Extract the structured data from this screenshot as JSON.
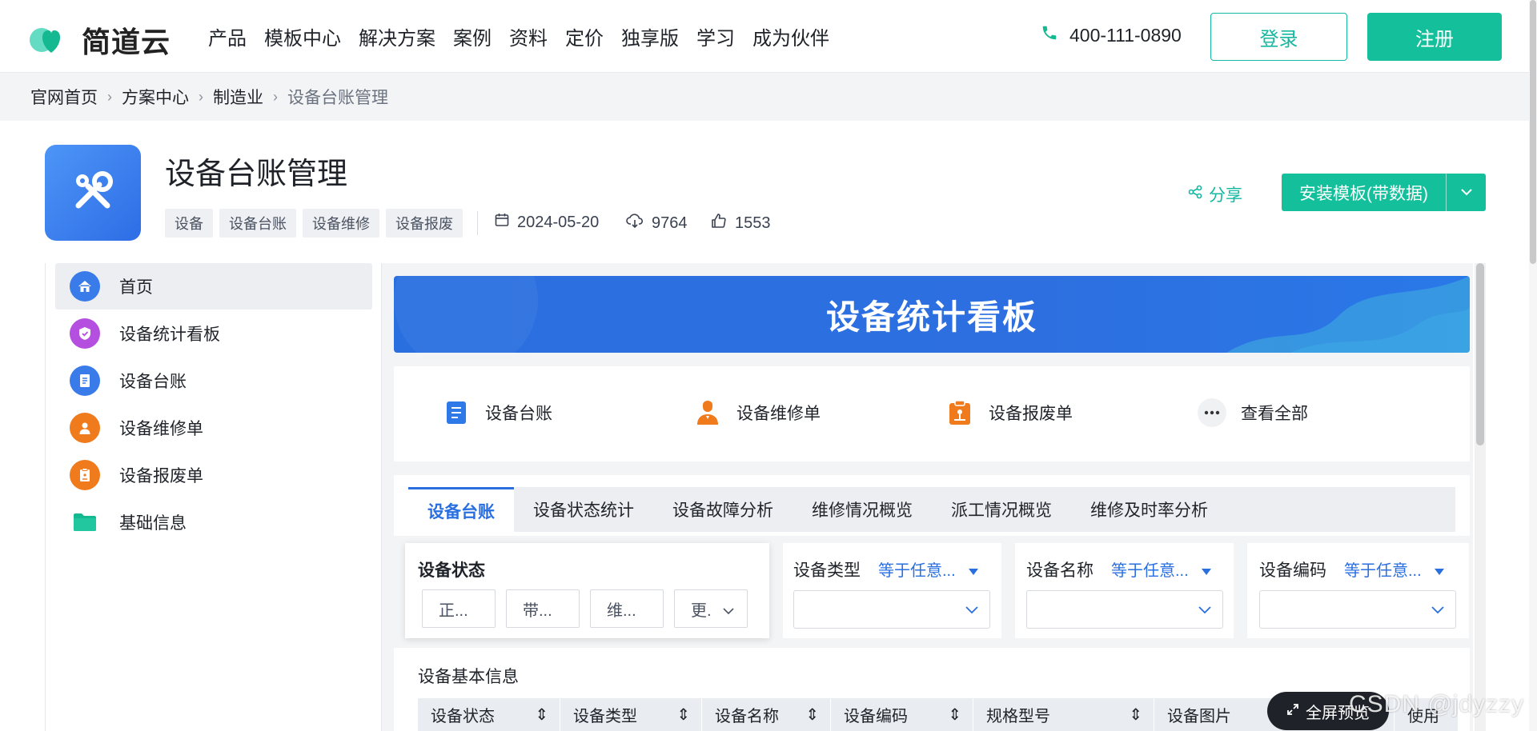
{
  "brand": {
    "name": "简道云"
  },
  "nav": {
    "items": [
      "产品",
      "模板中心",
      "解决方案",
      "案例",
      "资料",
      "定价",
      "独享版",
      "学习",
      "成为伙伴"
    ]
  },
  "header": {
    "phone": "400-111-0890",
    "login": "登录",
    "register": "注册"
  },
  "breadcrumb": [
    "官网首页",
    "方案中心",
    "制造业",
    "设备台账管理"
  ],
  "template": {
    "title": "设备台账管理",
    "tags": [
      "设备",
      "设备台账",
      "设备维修",
      "设备报废"
    ],
    "date": "2024-05-20",
    "downloads": "9764",
    "likes": "1553",
    "share": "分享",
    "install": "安装模板(带数据)"
  },
  "sidebar": {
    "items": [
      {
        "label": "首页",
        "icon": "home-icon",
        "color": "#3a7bea"
      },
      {
        "label": "设备统计看板",
        "icon": "shield-icon",
        "color": "#b44fe0"
      },
      {
        "label": "设备台账",
        "icon": "document-icon",
        "color": "#3a7bea"
      },
      {
        "label": "设备维修单",
        "icon": "worker-icon",
        "color": "#f07b1c"
      },
      {
        "label": "设备报废单",
        "icon": "clipboard-icon",
        "color": "#f07b1c"
      },
      {
        "label": "基础信息",
        "icon": "folder-icon",
        "color": "#14b891"
      }
    ]
  },
  "banner": {
    "title": "设备统计看板"
  },
  "quick_links": [
    "设备台账",
    "设备维修单",
    "设备报废单",
    "查看全部"
  ],
  "tabs": [
    "设备台账",
    "设备状态统计",
    "设备故障分析",
    "维修情况概览",
    "派工情况概览",
    "维修及时率分析"
  ],
  "filters": {
    "status_label": "设备状态",
    "status_chips": [
      "正...",
      "带...",
      "维...",
      "更."
    ],
    "fields": [
      {
        "label": "设备类型",
        "op": "等于任意..."
      },
      {
        "label": "设备名称",
        "op": "等于任意..."
      },
      {
        "label": "设备编码",
        "op": "等于任意..."
      }
    ]
  },
  "table": {
    "title": "设备基本信息",
    "columns": [
      "设备状态",
      "设备类型",
      "设备名称",
      "设备编码",
      "规格型号",
      "设备图片",
      "使用"
    ]
  },
  "preview": {
    "fullscreen": "全屏预览"
  },
  "watermark": "CSDN @jdyzzy",
  "colors": {
    "accent": "#14c09b",
    "blue": "#2a6fe0"
  }
}
